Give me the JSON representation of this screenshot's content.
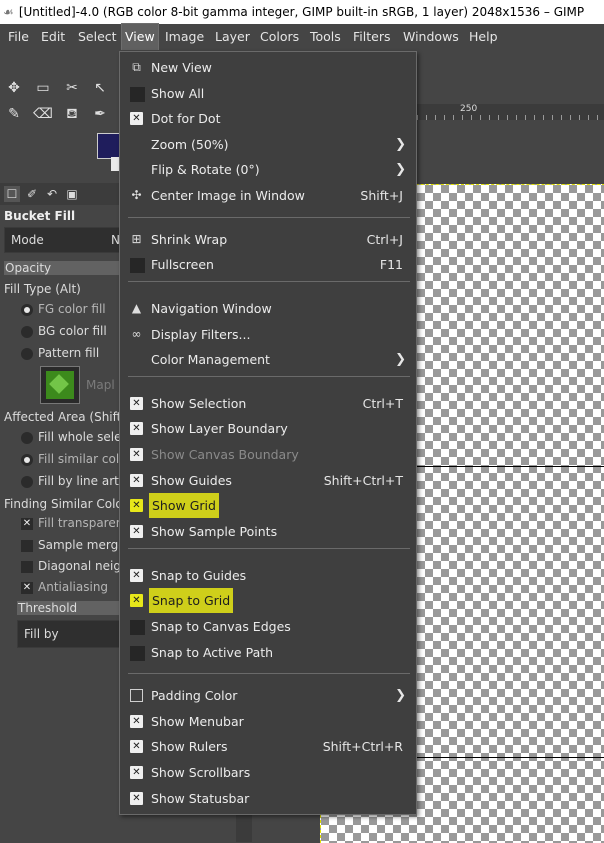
{
  "window": {
    "title": "[Untitled]-4.0 (RGB color 8-bit gamma integer, GIMP built-in sRGB, 1 layer) 2048x1536 – GIMP",
    "title_icon": "gimp-wilber-icon"
  },
  "menubar": [
    "File",
    "Edit",
    "Select",
    "View",
    "Image",
    "Layer",
    "Colors",
    "Tools",
    "Filters",
    "Windows",
    "Help"
  ],
  "active_menu": "View",
  "ruler": {
    "label": "250"
  },
  "tool_options": {
    "title": "Bucket Fill",
    "mode_label": "Mode",
    "mode_value": "N",
    "opacity_label": "Opacity",
    "fill_type_label": "Fill Type  (Alt)",
    "fill_type_options": [
      "FG color fill",
      "BG color fill",
      "Pattern fill"
    ],
    "pattern_name": "Mapl",
    "affected_area_label": "Affected Area  (Shift)",
    "affected_area_options": [
      "Fill whole sele",
      "Fill similar colo",
      "Fill by line art"
    ],
    "finding_similar_label": "Finding Similar Colors",
    "finding_options": [
      "Fill transparen",
      "Sample merge",
      "Diagonal neigh",
      "Antialiasing"
    ],
    "threshold_label": "Threshold",
    "fill_by_label": "Fill by"
  },
  "view_menu": {
    "items": [
      {
        "label": "New View",
        "icon": "new-view-icon",
        "state": "icon",
        "accel": "",
        "submenu": false
      },
      {
        "label": "Show All",
        "icon": "unchecked-box-icon",
        "state": "off",
        "accel": "",
        "submenu": false
      },
      {
        "label": "Dot for Dot",
        "icon": "checked-box-icon",
        "state": "on",
        "accel": "",
        "submenu": false
      },
      {
        "label": "Zoom (50%)",
        "icon": "",
        "state": "none",
        "accel": "",
        "submenu": true
      },
      {
        "label": "Flip & Rotate (0°)",
        "icon": "",
        "state": "none",
        "accel": "",
        "submenu": true
      },
      {
        "label": "Center Image in Window",
        "icon": "center-image-icon",
        "state": "icon",
        "accel": "Shift+J",
        "submenu": false
      },
      {
        "label": "Shrink Wrap",
        "icon": "shrink-wrap-icon",
        "state": "icon",
        "accel": "Ctrl+J",
        "submenu": false
      },
      {
        "label": "Fullscreen",
        "icon": "unchecked-box-icon",
        "state": "off",
        "accel": "F11",
        "submenu": false
      },
      {
        "label": "Navigation Window",
        "icon": "navigation-icon",
        "state": "icon",
        "accel": "",
        "submenu": false
      },
      {
        "label": "Display Filters...",
        "icon": "display-filters-icon",
        "state": "icon",
        "accel": "",
        "submenu": false
      },
      {
        "label": "Color Management",
        "icon": "",
        "state": "none",
        "accel": "",
        "submenu": true
      },
      {
        "label": "Show Selection",
        "icon": "checked-box-icon",
        "state": "on",
        "accel": "Ctrl+T",
        "submenu": false
      },
      {
        "label": "Show Layer Boundary",
        "icon": "checked-box-icon",
        "state": "on",
        "accel": "",
        "submenu": false
      },
      {
        "label": "Show Canvas Boundary",
        "icon": "checked-box-icon",
        "state": "on-disabled",
        "accel": "",
        "submenu": false
      },
      {
        "label": "Show Guides",
        "icon": "checked-box-icon",
        "state": "on",
        "accel": "Shift+Ctrl+T",
        "submenu": false
      },
      {
        "label": "Show Grid",
        "icon": "checked-box-icon",
        "state": "on-highlighted",
        "accel": "",
        "submenu": false
      },
      {
        "label": "Show Sample Points",
        "icon": "checked-box-icon",
        "state": "on",
        "accel": "",
        "submenu": false
      },
      {
        "label": "Snap to Guides",
        "icon": "checked-box-icon",
        "state": "on",
        "accel": "",
        "submenu": false
      },
      {
        "label": "Snap to Grid",
        "icon": "checked-box-icon",
        "state": "on-highlighted",
        "accel": "",
        "submenu": false
      },
      {
        "label": "Snap to Canvas Edges",
        "icon": "unchecked-box-icon",
        "state": "off",
        "accel": "",
        "submenu": false
      },
      {
        "label": "Snap to Active Path",
        "icon": "unchecked-box-icon",
        "state": "off",
        "accel": "",
        "submenu": false
      },
      {
        "label": "Padding Color",
        "icon": "padding-color-icon",
        "state": "icon",
        "accel": "",
        "submenu": true
      },
      {
        "label": "Show Menubar",
        "icon": "checked-box-icon",
        "state": "on",
        "accel": "",
        "submenu": false
      },
      {
        "label": "Show Rulers",
        "icon": "checked-box-icon",
        "state": "on",
        "accel": "Shift+Ctrl+R",
        "submenu": false
      },
      {
        "label": "Show Scrollbars",
        "icon": "checked-box-icon",
        "state": "on",
        "accel": "",
        "submenu": false
      },
      {
        "label": "Show Statusbar",
        "icon": "checked-box-icon",
        "state": "on",
        "accel": "",
        "submenu": false
      }
    ]
  },
  "colors": {
    "highlight": "#cfcf1a",
    "fg_color": "#1f1d5c",
    "menu_bg": "#3f3f3f"
  }
}
